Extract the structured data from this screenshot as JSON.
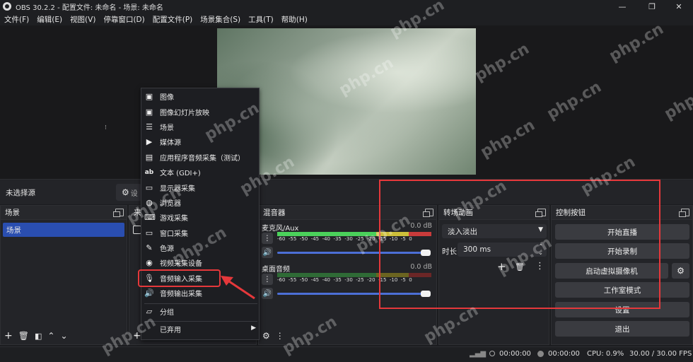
{
  "window": {
    "title": "OBS 30.2.2 - 配置文件: 未命名 - 场景: 未命名",
    "min": "—",
    "restore": "❐",
    "close": "✕"
  },
  "menu": [
    "文件(F)",
    "编辑(E)",
    "视图(V)",
    "停靠窗口(D)",
    "配置文件(P)",
    "场景集合(S)",
    "工具(T)",
    "帮助(H)"
  ],
  "source_bar": {
    "no_source": "未选择源",
    "settings_partial": "设"
  },
  "scenes": {
    "title": "场景",
    "items": [
      "场景"
    ]
  },
  "sources": {
    "title_partial": "来"
  },
  "mixer": {
    "title": "混音器",
    "channels": [
      {
        "name": "麦克风/Aux",
        "db": "0.0 dB"
      },
      {
        "name": "桌面音频",
        "db": "0.0 dB"
      }
    ],
    "scale": [
      "-60",
      "-55",
      "-50",
      "-45",
      "-40",
      "-35",
      "-30",
      "-25",
      "-20",
      "-15",
      "-10",
      "-5",
      "0"
    ]
  },
  "transitions": {
    "title": "转场动画",
    "selected": "淡入淡出",
    "duration_label": "时长",
    "duration_value": "300 ms"
  },
  "controls": {
    "title": "控制按钮",
    "start_stream": "开始直播",
    "start_record": "开始录制",
    "virtual_cam": "启动虚拟摄像机",
    "studio_mode": "工作室模式",
    "settings": "设置",
    "exit": "退出"
  },
  "context_menu": {
    "items": [
      "图像",
      "图像幻灯片放映",
      "场景",
      "媒体源",
      "应用程序音频采集（测试）",
      "文本 (GDI+)",
      "显示器采集",
      "浏览器",
      "游戏采集",
      "窗口采集",
      "色源",
      "视频采集设备",
      "音频输入采集",
      "音频输出采集"
    ],
    "group": "分组",
    "deprecated": "已弃用",
    "highlighted": "音频输入采集"
  },
  "status": {
    "time1": "00:00:00",
    "time2": "00:00:00",
    "cpu": "CPU: 0.9%",
    "fps": "30.00 / 30.00 FPS"
  },
  "watermark": "php.cn",
  "colors": {
    "accent": "#2a4eb0",
    "highlight": "#e5383b",
    "meter_green": "#4bd15b",
    "meter_yellow": "#cdbf3a",
    "meter_red": "#c93b3b"
  }
}
